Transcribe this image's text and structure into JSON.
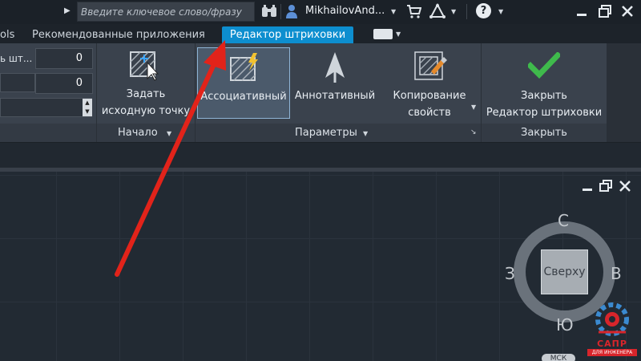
{
  "topbar": {
    "search_placeholder": "Введите ключевое слово/фразу",
    "user_name": "MikhailovAnd...",
    "icons": [
      "binoculars-icon",
      "user-icon",
      "cart-icon",
      "a360-icon",
      "help-icon",
      "minimize-icon",
      "restore-icon",
      "close-icon"
    ]
  },
  "tabs": {
    "tools": "ols",
    "recommended": "Рекомендованные приложения",
    "hatch_editor": "Редактор штриховки"
  },
  "ribbon": {
    "left_fields": {
      "label_top": "ь шт...",
      "value_top": "0",
      "value_mid": "0"
    },
    "origin": {
      "set_origin_label_1": "Задать",
      "set_origin_label_2": "исходную точку",
      "panel_label": "Начало"
    },
    "options": {
      "associative": "Ассоциативный",
      "annotative": "Аннотативный",
      "match_props_1": "Копирование",
      "match_props_2": "свойств",
      "panel_label": "Параметры"
    },
    "close": {
      "close_label_1": "Закрыть",
      "close_label_2": "Редактор штриховки",
      "panel_label": "Закрыть"
    }
  },
  "viewcube": {
    "face": "Сверху",
    "north": "С",
    "south": "Ю",
    "east": "В",
    "west": "З",
    "wcs_badge": "МСК"
  },
  "logo": {
    "text": "САПР",
    "subtext": "ДЛЯ ИНЖЕНЕРА"
  },
  "colors": {
    "active_tab": "#0d8ecf",
    "ribbon_bg": "#3a424d",
    "annotation_arrow": "#e2231a",
    "checkmark": "#3fba4c"
  }
}
